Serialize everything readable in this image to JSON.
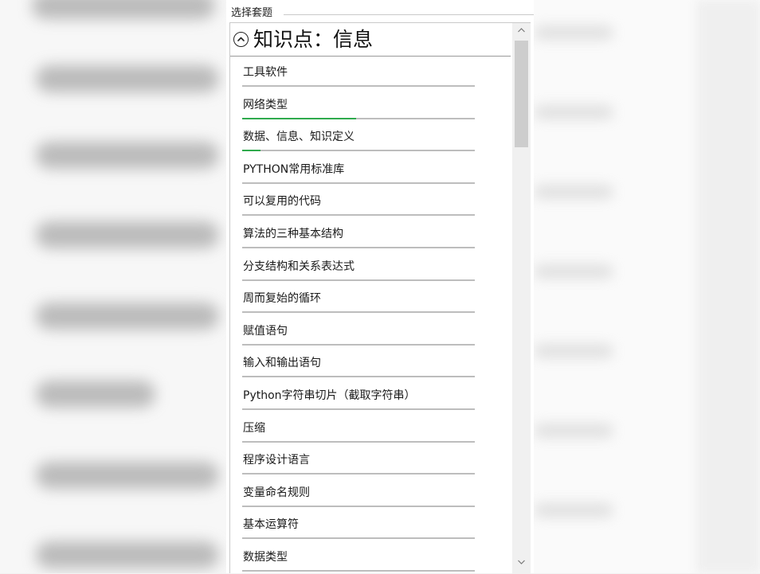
{
  "group": {
    "legend": "选择套题"
  },
  "header": {
    "title": "知识点：信息"
  },
  "items": [
    {
      "label": "工具软件",
      "progress": 0
    },
    {
      "label": "网络类型",
      "progress": 0.49
    },
    {
      "label": "数据、信息、知识定义",
      "progress": 0.08
    },
    {
      "label": "PYTHON常用标准库",
      "progress": 0
    },
    {
      "label": "可以复用的代码",
      "progress": 0
    },
    {
      "label": "算法的三种基本结构",
      "progress": 0
    },
    {
      "label": "分支结构和关系表达式",
      "progress": 0
    },
    {
      "label": "周而复始的循环",
      "progress": 0
    },
    {
      "label": "赋值语句",
      "progress": 0
    },
    {
      "label": "输入和输出语句",
      "progress": 0
    },
    {
      "label": "Python字符串切片（截取字符串）",
      "progress": 0
    },
    {
      "label": "压缩",
      "progress": 0
    },
    {
      "label": "程序设计语言",
      "progress": 0
    },
    {
      "label": "变量命名规则",
      "progress": 0
    },
    {
      "label": "基本运算符",
      "progress": 0
    },
    {
      "label": "数据类型",
      "progress": 0
    }
  ],
  "colors": {
    "progress": "#2faa4d",
    "track": "#bdbdbd"
  },
  "icons": {
    "header": "chevron-up-circle-icon",
    "scroll_up": "scroll-up-arrow-icon",
    "scroll_down": "scroll-down-arrow-icon"
  }
}
